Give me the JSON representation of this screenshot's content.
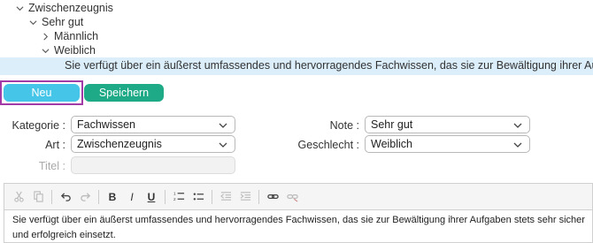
{
  "tree": {
    "level0": "Zwischenzeugnis",
    "level1": "Sehr gut",
    "level2a": "Männlich",
    "level2b": "Weiblich",
    "selected_text": "Sie verfügt über ein äußerst umfassendes und hervorragendes Fachwissen, das sie zur Bewältigung ihrer Aufgaben stets sehr sicher und erfolgreich einsetzt."
  },
  "buttons": {
    "new_label": "Neu",
    "save_label": "Speichern"
  },
  "form": {
    "kategorie_label": "Kategorie :",
    "kategorie_value": "Fachwissen",
    "art_label": "Art :",
    "art_value": "Zwischenzeugnis",
    "titel_label": "Titel :",
    "note_label": "Note :",
    "note_value": "Sehr gut",
    "geschlecht_label": "Geschlecht :",
    "geschlecht_value": "Weiblich"
  },
  "toolbar": {
    "bold": "B",
    "italic": "I",
    "underline": "U"
  },
  "editor": {
    "content": "Sie verfügt über ein äußerst umfassendes und hervorragendes Fachwissen, das sie zur Bewältigung ihrer Aufgaben stets sehr sicher und erfolgreich einsetzt."
  },
  "colors": {
    "new_button": "#45c6e8",
    "save_button": "#1eaa86",
    "selection": "#dbeefa",
    "focus_outline": "#a23ba8"
  }
}
